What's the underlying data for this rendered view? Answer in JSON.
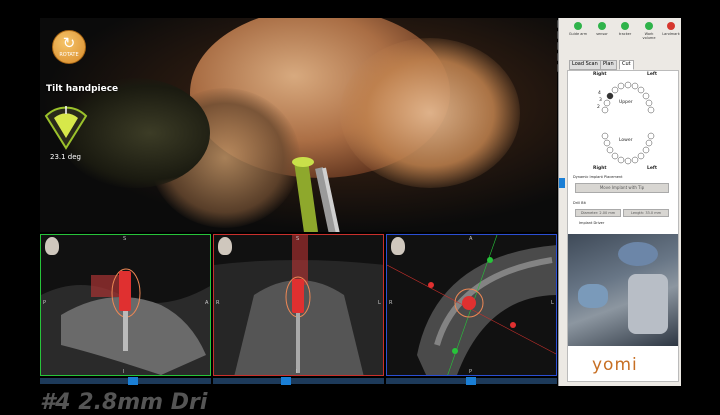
{
  "view3d": {
    "rotate_label": "ROTATE",
    "tilt_label": "Tilt handpiece",
    "tilt_value": "23.1 deg"
  },
  "slices": [
    {
      "top": "S",
      "left": "P",
      "right": "A",
      "bottom": "I"
    },
    {
      "top": "S",
      "left": "R",
      "right": "L",
      "bottom": "I"
    },
    {
      "top": "A",
      "left": "R",
      "right": "L",
      "bottom": "P"
    }
  ],
  "status_lamps": [
    {
      "label": "Guide arm",
      "color": "#2fb34a"
    },
    {
      "label": "sensor",
      "color": "#2fb34a"
    },
    {
      "label": "tracker",
      "color": "#2fb34a"
    },
    {
      "label": "Work volume",
      "color": "#2fb34a"
    },
    {
      "label": "Landmark",
      "color": "#d6372e"
    }
  ],
  "tabs": [
    "Load Scan",
    "Plan",
    "Cut"
  ],
  "active_tab": "Cut",
  "dental_chart": {
    "right": "Right",
    "left": "Left",
    "upper": "Upper",
    "lower": "Lower",
    "tooth_numbers": [
      "4",
      "3",
      "2"
    ]
  },
  "controls": {
    "dynamic_label": "Dynamic Implant Placement",
    "move_button": "Move Implant with Tip",
    "drill_label": "Drill Bit",
    "diameter_label": "Diameter: 2.00 mm",
    "length_label": "Length: 33.0 mm",
    "implant_driver": "Implant Driver"
  },
  "logo": "yomi",
  "caption": "#4  2.8mm  Dri"
}
